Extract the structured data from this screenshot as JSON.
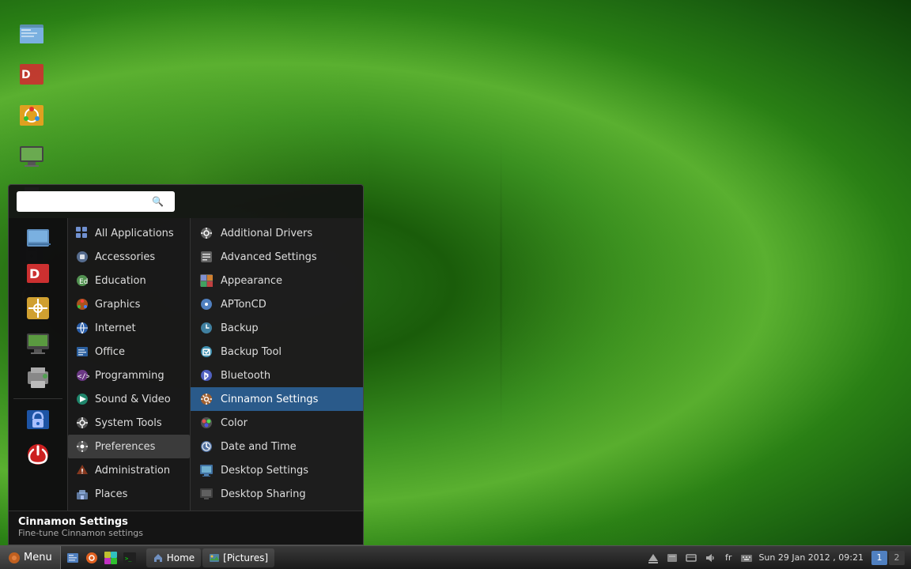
{
  "desktop": {
    "background_desc": "green leaf with water drops"
  },
  "taskbar": {
    "menu_label": "Menu",
    "apps": [
      {
        "label": "Home",
        "icon": "🏠"
      },
      {
        "label": "[Pictures]",
        "icon": "🖼"
      }
    ],
    "datetime": "Sun 29 Jan 2012 , 09:21",
    "lang": "fr",
    "workspace": "1 2"
  },
  "desktop_icons": [
    {
      "label": "",
      "icon_type": "files"
    },
    {
      "label": "",
      "icon_type": "dvd"
    },
    {
      "label": "",
      "icon_type": "paint"
    },
    {
      "label": "",
      "icon_type": "monitor"
    },
    {
      "label": "",
      "icon_type": "printer"
    },
    {
      "label": "",
      "icon_type": "divider"
    },
    {
      "label": "",
      "icon_type": "lock"
    },
    {
      "label": "",
      "icon_type": "power"
    }
  ],
  "menu": {
    "search_placeholder": "",
    "categories": [
      {
        "label": "All Applications",
        "icon_type": "grid"
      },
      {
        "label": "Accessories",
        "icon_type": "briefcase"
      },
      {
        "label": "Education",
        "icon_type": "education"
      },
      {
        "label": "Graphics",
        "icon_type": "graphics"
      },
      {
        "label": "Internet",
        "icon_type": "internet"
      },
      {
        "label": "Office",
        "icon_type": "office"
      },
      {
        "label": "Programming",
        "icon_type": "programming"
      },
      {
        "label": "Sound & Video",
        "icon_type": "sound"
      },
      {
        "label": "System Tools",
        "icon_type": "system"
      },
      {
        "label": "Preferences",
        "icon_type": "preferences"
      },
      {
        "label": "Administration",
        "icon_type": "admin"
      },
      {
        "label": "Places",
        "icon_type": "places"
      }
    ],
    "apps": [
      {
        "label": "Additional Drivers",
        "icon_type": "settings",
        "highlighted": false
      },
      {
        "label": "Advanced Settings",
        "icon_type": "settings2",
        "highlighted": false
      },
      {
        "label": "Appearance",
        "icon_type": "appearance",
        "highlighted": false
      },
      {
        "label": "APTonCD",
        "icon_type": "cd",
        "highlighted": false
      },
      {
        "label": "Backup",
        "icon_type": "backup",
        "highlighted": false
      },
      {
        "label": "Backup Tool",
        "icon_type": "backup2",
        "highlighted": false
      },
      {
        "label": "Bluetooth",
        "icon_type": "bluetooth",
        "highlighted": false
      },
      {
        "label": "Cinnamon Settings",
        "icon_type": "cinnamon",
        "highlighted": true
      },
      {
        "label": "Color",
        "icon_type": "color",
        "highlighted": false
      },
      {
        "label": "Date and Time",
        "icon_type": "datetime",
        "highlighted": false
      },
      {
        "label": "Desktop Settings",
        "icon_type": "desktop",
        "highlighted": false
      },
      {
        "label": "Desktop Sharing",
        "icon_type": "share",
        "highlighted": false
      }
    ],
    "tooltip": {
      "title": "Cinnamon Settings",
      "description": "Fine-tune Cinnamon settings"
    }
  }
}
